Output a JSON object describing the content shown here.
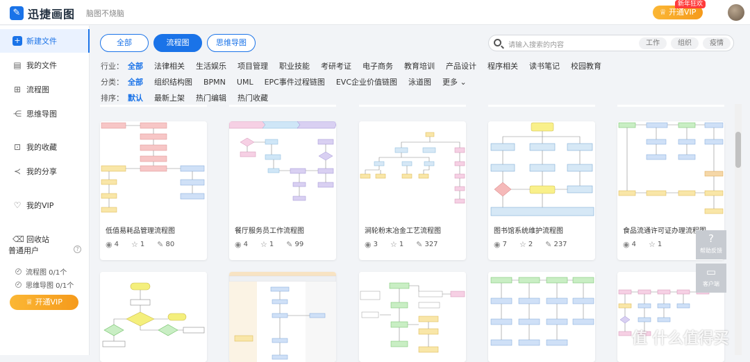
{
  "app": {
    "name": "迅捷画图",
    "slogan": "脑图不烧脑",
    "vip_button": "开通VIP",
    "vip_badge": "新年狂欢"
  },
  "sidebar": {
    "items": [
      {
        "label": "新建文件",
        "icon": "plus-icon"
      },
      {
        "label": "我的文件",
        "icon": "file-icon"
      },
      {
        "label": "流程图",
        "icon": "flowchart-icon"
      },
      {
        "label": "思维导图",
        "icon": "mindmap-icon"
      },
      {
        "label": "我的收藏",
        "icon": "bookmark-icon"
      },
      {
        "label": "我的分享",
        "icon": "share-icon"
      },
      {
        "label": "我的VIP",
        "icon": "vip-icon"
      },
      {
        "label": "回收站",
        "icon": "trash-icon"
      }
    ],
    "user_type": "普通用户",
    "quota_flow": "流程图 0/1个",
    "quota_mind": "思维导图 0/1个",
    "vip_button": "开通VIP"
  },
  "tabs": [
    "全部",
    "流程图",
    "思维导图"
  ],
  "search": {
    "placeholder": "请输入搜索的内容",
    "chips": [
      "工作",
      "组织",
      "疫情"
    ]
  },
  "filters": {
    "industry_label": "行业：",
    "industry": [
      "全部",
      "法律相关",
      "生活娱乐",
      "项目管理",
      "职业技能",
      "考研考证",
      "电子商务",
      "教育培训",
      "产品设计",
      "程序相关",
      "读书笔记",
      "校园教育"
    ],
    "category_label": "分类：",
    "category": [
      "全部",
      "组织结构图",
      "BPMN",
      "UML",
      "EPC事件过程链图",
      "EVC企业价值链图",
      "泳道图",
      "更多"
    ],
    "sort_label": "排序：",
    "sort": [
      "默认",
      "最新上架",
      "热门编辑",
      "热门收藏"
    ]
  },
  "cards": [
    {
      "title": "低值易耗品管理流程图",
      "views": "4",
      "stars": "1",
      "edits": "80"
    },
    {
      "title": "餐厅服务员工作流程图",
      "views": "4",
      "stars": "1",
      "edits": "99"
    },
    {
      "title": "涧轮粉末冶金工艺流程图",
      "views": "3",
      "stars": "1",
      "edits": "327"
    },
    {
      "title": "图书馆系统维护流程图",
      "views": "7",
      "stars": "2",
      "edits": "237"
    },
    {
      "title": "食品流通许可证办理流程图",
      "views": "4",
      "stars": "1",
      "edits": ""
    }
  ],
  "float": {
    "help": "帮助反馈",
    "client": "客户端"
  },
  "watermark": "值 什么值得买"
}
